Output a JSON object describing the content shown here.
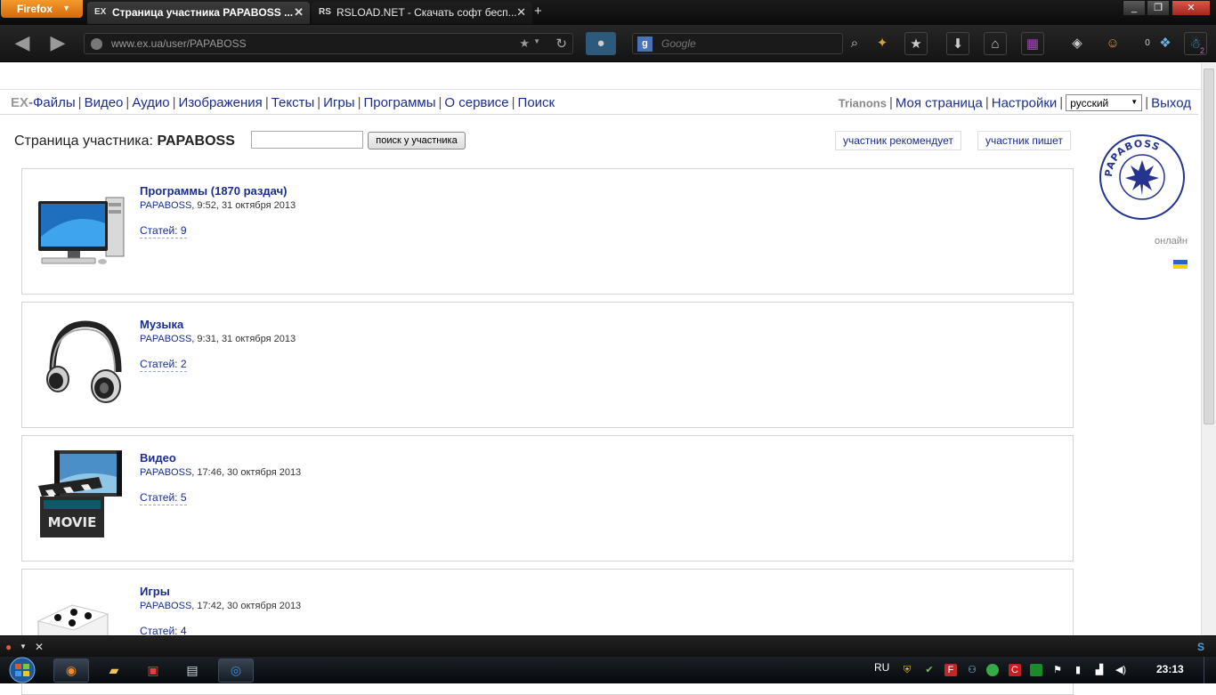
{
  "browser": {
    "menu_label": "Firefox",
    "tabs": [
      {
        "favicon": "EX",
        "title": "Страница участника PAPABOSS ...",
        "active": true
      },
      {
        "favicon": "RS",
        "title": "RSLOAD.NET - Скачать софт бесп...",
        "active": false
      }
    ],
    "url": "www.ex.ua/user/PAPABOSS",
    "search_placeholder": "Google",
    "counter_badge": "0",
    "notif_badge": "2"
  },
  "site": {
    "logo": "EX",
    "nav": [
      "-Файлы",
      "Видео",
      "Аудио",
      "Изображения",
      "Тексты",
      "Игры",
      "Программы",
      "О сервисе",
      "Поиск"
    ],
    "user_name": "Trianons",
    "user_links": [
      "Моя страница",
      "Настройки"
    ],
    "language": "русский",
    "logout": "Выход"
  },
  "page": {
    "heading_prefix": "Страница участника:",
    "heading_user": "PAPABOSS",
    "search_button": "поиск у участника",
    "tag_recommends": "участник рекомендует",
    "tag_writes": "участник пишет",
    "status": "онлайн",
    "avatar_text": "PAPABOSS"
  },
  "categories": [
    {
      "title": "Программы (1870 раздач)",
      "author": "PAPABOSS",
      "date": "9:52, 31 октября 2013",
      "articles": "Статей: 9",
      "icon": "computer-icon"
    },
    {
      "title": "Музыка",
      "author": "PAPABOSS",
      "date": "9:31, 31 октября 2013",
      "articles": "Статей: 2",
      "icon": "headphones-icon"
    },
    {
      "title": "Видео",
      "author": "PAPABOSS",
      "date": "17:46, 30 октября 2013",
      "articles": "Статей: 5",
      "icon": "movie-clapper-icon"
    },
    {
      "title": "Игры",
      "author": "PAPABOSS",
      "date": "17:42, 30 октября 2013",
      "articles": "Статей: 4",
      "icon": "dice-icon"
    }
  ],
  "taskbar": {
    "lang": "RU",
    "clock": "23:13"
  }
}
